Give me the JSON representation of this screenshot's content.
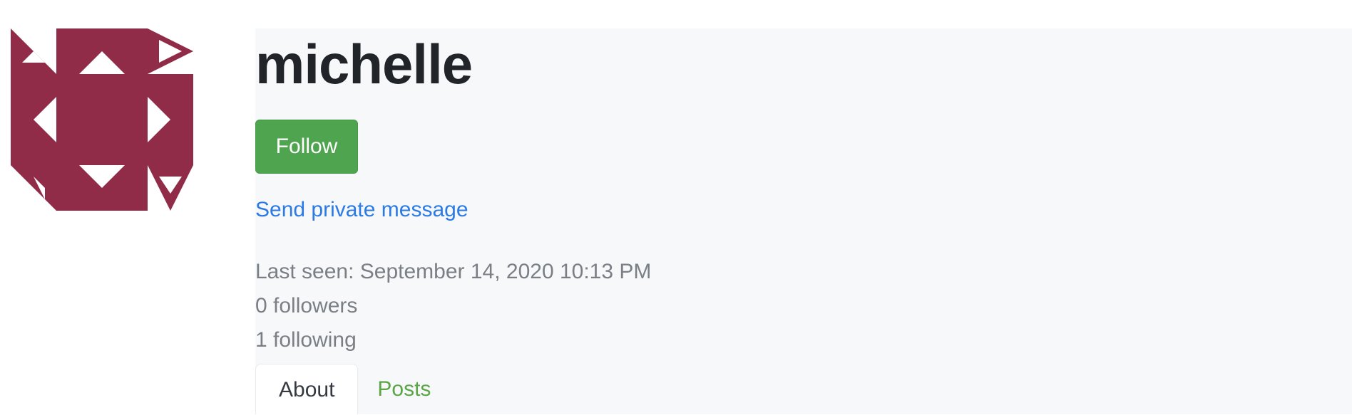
{
  "profile": {
    "username": "michelle",
    "follow_label": "Follow",
    "private_message_label": "Send private message",
    "last_seen": "Last seen: September 14, 2020 10:13 PM",
    "followers": "0 followers",
    "following": "1 following",
    "avatar_icon": "identicon-avatar"
  },
  "tabs": [
    {
      "label": "About",
      "active": true
    },
    {
      "label": "Posts",
      "active": false
    }
  ],
  "colors": {
    "avatar": "#912c48",
    "follow_button": "#4fa44f",
    "link": "#2c7be5",
    "meta_text": "#7a7f85",
    "panel_background": "#f7f8fa",
    "inactive_tab": "#5aa545"
  }
}
